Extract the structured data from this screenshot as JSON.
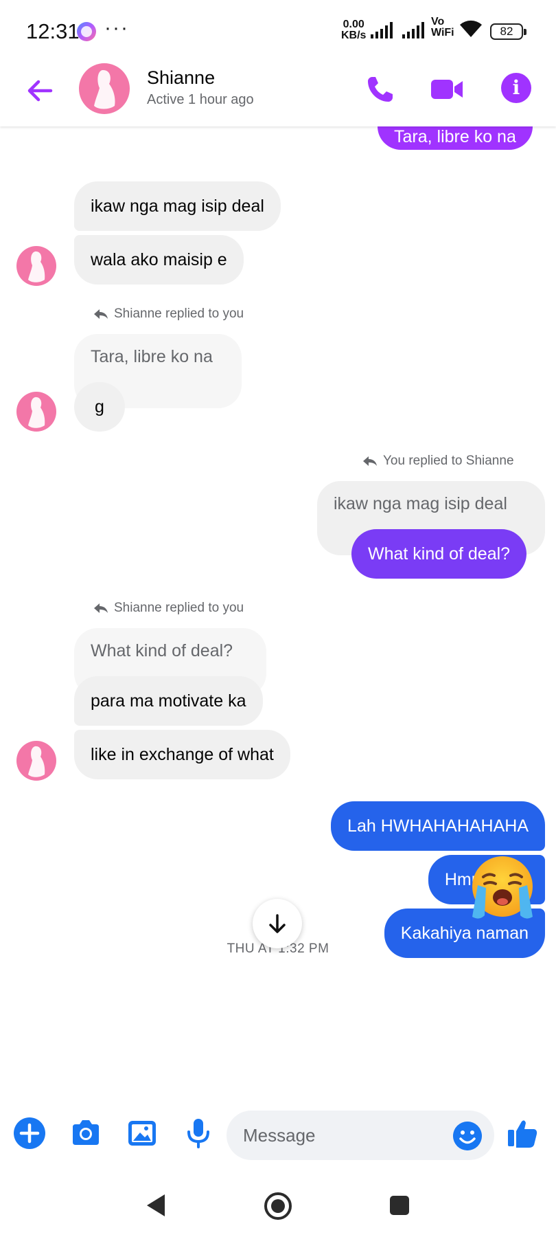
{
  "status_bar": {
    "time": "12:31",
    "overflow_dots": "···",
    "net_rate_value": "0.00",
    "net_rate_unit": "KB/s",
    "vowifi_top": "Vo",
    "vowifi_bottom": "WiFi",
    "battery": "82"
  },
  "header": {
    "contact_name": "Shianne",
    "contact_status": "Active 1 hour ago",
    "accent_color": "#a033ff"
  },
  "messages": {
    "m0_out": "Tara, libre ko na",
    "m1_in": "ikaw nga mag isip deal",
    "m2_in": "wala ako maisip e",
    "reply_note_1": "Shianne replied to you",
    "m3_quote": "Tara, libre ko na",
    "m3_in": "g",
    "reply_note_2": "You replied to Shianne",
    "m4_quote": "ikaw nga mag isip deal",
    "m4_out": "What kind of deal?",
    "reply_note_3": "Shianne replied to you",
    "m5_quote": "What kind of deal?",
    "m5_in": "para ma motivate ka",
    "m6_in": "like in exchange of what",
    "m7_out": "Lah HWHAHAHAHAHA",
    "m8_out": "Hmmmmm",
    "m9_out": "Kakahiya naman",
    "m10_emoji": "loudly-crying-face"
  },
  "timestamp": "THU AT 1:32 PM",
  "composer": {
    "placeholder": "Message"
  },
  "colors": {
    "bubble_purple": "#a033ff",
    "bubble_violet": "#7a3cf5",
    "bubble_blue": "#2563eb",
    "composer_blue": "#1877f2",
    "incoming_bg": "#f0f0f0"
  }
}
